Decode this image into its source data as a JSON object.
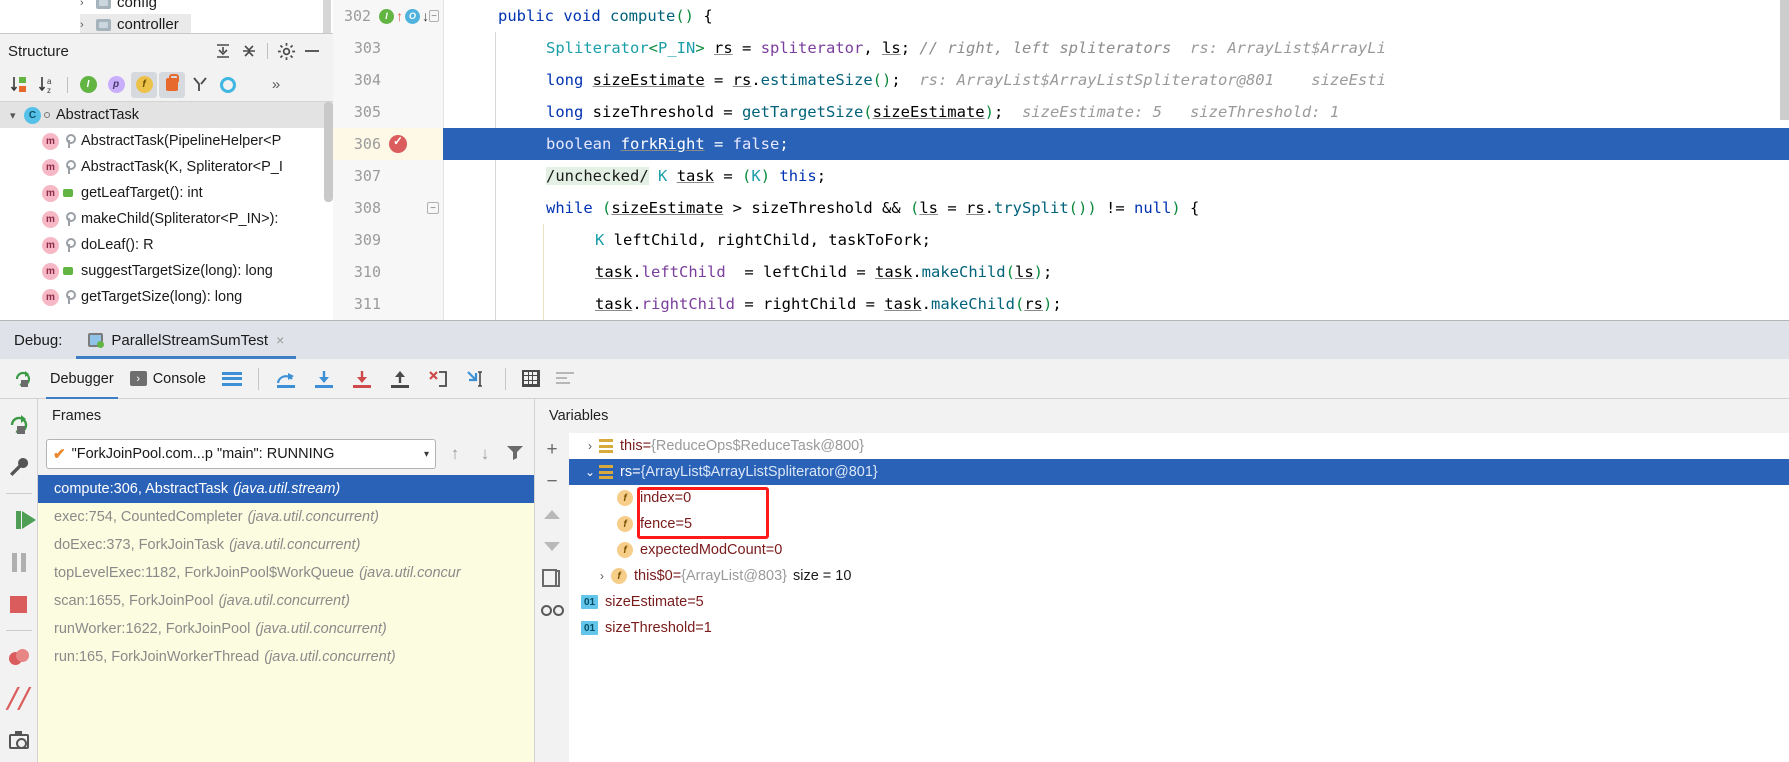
{
  "project_tree": {
    "items": [
      {
        "label": "config",
        "icon": "folder-icon"
      },
      {
        "label": "controller",
        "icon": "folder-icon"
      }
    ]
  },
  "structure": {
    "title": "Structure",
    "header_icons": [
      "expand-all-icon",
      "collapse-all-icon",
      "settings-gear-icon",
      "hide-panel-icon"
    ],
    "toolbar_icons": [
      "sort-by-visibility-icon",
      "sort-alphabetically-icon",
      "show-inherited-icon",
      "show-properties-icon",
      "show-fields-icon",
      "show-non-public-icon",
      "show-anonymous-icon",
      "show-interfaces-icon",
      "more-icon"
    ],
    "more_label": "»",
    "items": [
      {
        "label": "AbstractTask",
        "kind": "class",
        "selected": true,
        "expander": "⌄"
      },
      {
        "label": "AbstractTask(PipelineHelper<P",
        "kind": "method",
        "vis": "private"
      },
      {
        "label": "AbstractTask(K, Spliterator<P_I",
        "kind": "method",
        "vis": "private"
      },
      {
        "label": "getLeafTarget(): int",
        "kind": "method",
        "vis": "public"
      },
      {
        "label": "makeChild(Spliterator<P_IN>):",
        "kind": "method",
        "vis": "private"
      },
      {
        "label": "doLeaf(): R",
        "kind": "method",
        "vis": "private"
      },
      {
        "label": "suggestTargetSize(long): long",
        "kind": "method",
        "vis": "public"
      },
      {
        "label": "getTargetSize(long): long",
        "kind": "method",
        "vis": "private"
      }
    ]
  },
  "editor": {
    "lines": [
      {
        "num": "302",
        "current": false,
        "gutter": [
          "in-badge",
          "arrow-up",
          "out-badge",
          "arrow-down"
        ],
        "fold": "minus"
      },
      {
        "num": "303",
        "current": false
      },
      {
        "num": "304",
        "current": false
      },
      {
        "num": "305",
        "current": false
      },
      {
        "num": "306",
        "current": true,
        "gutter": [
          "breakpoint-verified"
        ]
      },
      {
        "num": "307",
        "current": false
      },
      {
        "num": "308",
        "current": false,
        "fold": "minus"
      },
      {
        "num": "309",
        "current": false
      },
      {
        "num": "310",
        "current": false
      },
      {
        "num": "311",
        "current": false
      }
    ],
    "code": {
      "l302": "public void compute() {",
      "l303_code": "Spliterator<P_IN> rs = spliterator, ls;",
      "l303_comment": "// right, left spliterators",
      "l303_hint": "rs: ArrayList$ArrayLi",
      "l304_code": "long sizeEstimate = rs.estimateSize();",
      "l304_hint1": "rs: ArrayList$ArrayListSpliterator@801",
      "l304_hint2": "sizeEsti",
      "l305_code": "long sizeThreshold = getTargetSize(sizeEstimate);",
      "l305_hint1": "sizeEstimate: 5",
      "l305_hint2": "sizeThreshold: 1",
      "l306_code": "boolean forkRight = false;",
      "l307_annot": "/unchecked/",
      "l307_code": "K task = (K) this;",
      "l308_code": "while (sizeEstimate > sizeThreshold && (ls = rs.trySplit()) != null) {",
      "l309_code": "K leftChild, rightChild, taskToFork;",
      "l310_code": "task.leftChild  = leftChild = task.makeChild(ls);",
      "l311_code": "task.rightChild = rightChild = task.makeChild(rs);"
    }
  },
  "debug": {
    "window_label": "Debug:",
    "tab": {
      "name": "ParallelStreamSumTest",
      "close": "×",
      "icon": "run-configuration-icon"
    },
    "toolbar": {
      "rerun_icon": "rerun-icon",
      "debugger_label": "Debugger",
      "console_label": "Console",
      "console_icon": "console-icon",
      "layout_icon": "layout-settings-icon",
      "step_over_icon": "step-over-icon",
      "step_into_icon": "step-into-icon",
      "force_step_into_icon": "force-step-into-icon",
      "step_out_icon": "step-out-icon",
      "drop_frame_icon": "drop-frame-icon",
      "run_to_cursor_icon": "run-to-cursor-icon",
      "evaluate_icon": "evaluate-expression-icon",
      "sort_icon": "sort-values-icon"
    },
    "side_icons": [
      "rerun-icon",
      "settings-wrench-icon",
      "resume-program-icon",
      "pause-program-icon",
      "stop-icon",
      "mute-breakpoints-icon",
      "view-breakpoints-icon",
      "screenshot-icon"
    ],
    "frames": {
      "title": "Frames",
      "thread": {
        "label": "\"ForkJoinPool.com...p \"main\": RUNNING",
        "status_icon": "check-icon",
        "caret": "▾"
      },
      "nav": {
        "up": "↑",
        "down": "↓",
        "filter": "filter-icon"
      },
      "items": [
        {
          "text": "compute:306, AbstractTask",
          "pkg": "(java.util.stream)",
          "selected": true
        },
        {
          "text": "exec:754, CountedCompleter",
          "pkg": "(java.util.concurrent)",
          "selected": false
        },
        {
          "text": "doExec:373, ForkJoinTask",
          "pkg": "(java.util.concurrent)",
          "selected": false
        },
        {
          "text": "topLevelExec:1182, ForkJoinPool$WorkQueue",
          "pkg": "(java.util.concur",
          "selected": false
        },
        {
          "text": "scan:1655, ForkJoinPool",
          "pkg": "(java.util.concurrent)",
          "selected": false
        },
        {
          "text": "runWorker:1622, ForkJoinPool",
          "pkg": "(java.util.concurrent)",
          "selected": false
        },
        {
          "text": "run:165, ForkJoinWorkerThread",
          "pkg": "(java.util.concurrent)",
          "selected": false
        }
      ]
    },
    "variables": {
      "title": "Variables",
      "side_icons": [
        "add-watch-icon",
        "remove-watch-icon",
        "move-up-icon",
        "move-down-icon",
        "copy-icon",
        "inspect-icon"
      ],
      "add_label": "+",
      "remove_label": "−",
      "items": [
        {
          "arrow": "›",
          "icon": "object-icon",
          "name": "this",
          "eq": " = ",
          "value": "{ReduceOps$ReduceTask@800}",
          "extra": "",
          "selected": false,
          "indent": 0,
          "highlighted": false
        },
        {
          "arrow": "⌄",
          "icon": "object-icon",
          "name": "rs",
          "eq": " = ",
          "value": "{ArrayList$ArrayListSpliterator@801}",
          "extra": "",
          "selected": true,
          "indent": 0,
          "highlighted": false
        },
        {
          "arrow": "",
          "icon": "field-icon",
          "name": "index",
          "eq": " = ",
          "value": "0",
          "extra": "",
          "selected": false,
          "indent": 1,
          "highlighted": true
        },
        {
          "arrow": "",
          "icon": "field-icon",
          "name": "fence",
          "eq": " = ",
          "value": "5",
          "extra": "",
          "selected": false,
          "indent": 1,
          "highlighted": true
        },
        {
          "arrow": "",
          "icon": "field-icon",
          "name": "expectedModCount",
          "eq": " = ",
          "value": "0",
          "extra": "",
          "selected": false,
          "indent": 1,
          "highlighted": false
        },
        {
          "arrow": "›",
          "icon": "field-icon",
          "name": "this$0",
          "eq": " = ",
          "value": "{ArrayList@803}",
          "extra": "size = 10",
          "selected": false,
          "indent": 1,
          "highlighted": false
        },
        {
          "arrow": "",
          "icon": "number-icon",
          "name": "sizeEstimate",
          "eq": " = ",
          "value": "5",
          "extra": "",
          "selected": false,
          "indent": 0,
          "highlighted": false
        },
        {
          "arrow": "",
          "icon": "number-icon",
          "name": "sizeThreshold",
          "eq": " = ",
          "value": "1",
          "extra": "",
          "selected": false,
          "indent": 0,
          "highlighted": false
        }
      ]
    }
  },
  "colors": {
    "accent_blue": "#2a62b8",
    "highlight_red": "#ff1a1a",
    "frames_bg": "#fcfce0",
    "breakpoint_red": "#db5c5c"
  }
}
